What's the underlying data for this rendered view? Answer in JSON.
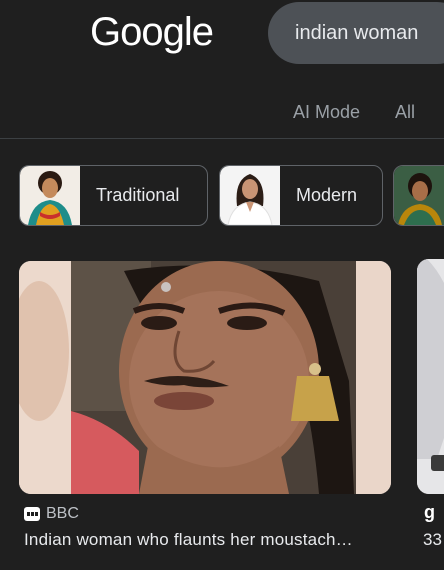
{
  "header": {
    "logo_text": "Google",
    "search_query": "indian woman"
  },
  "tabs": [
    {
      "label": "AI Mode"
    },
    {
      "label": "All"
    }
  ],
  "chips": [
    {
      "label": "Traditional"
    },
    {
      "label": "Modern"
    }
  ],
  "results": [
    {
      "source": "BBC",
      "title": "Indian woman who flaunts her moustach…"
    },
    {
      "source": "g",
      "title": "33"
    }
  ],
  "colors": {
    "background": "#1f1f1f",
    "search_box": "#4d5156",
    "muted_text": "#9aa0a6",
    "text": "#e8eaed"
  }
}
